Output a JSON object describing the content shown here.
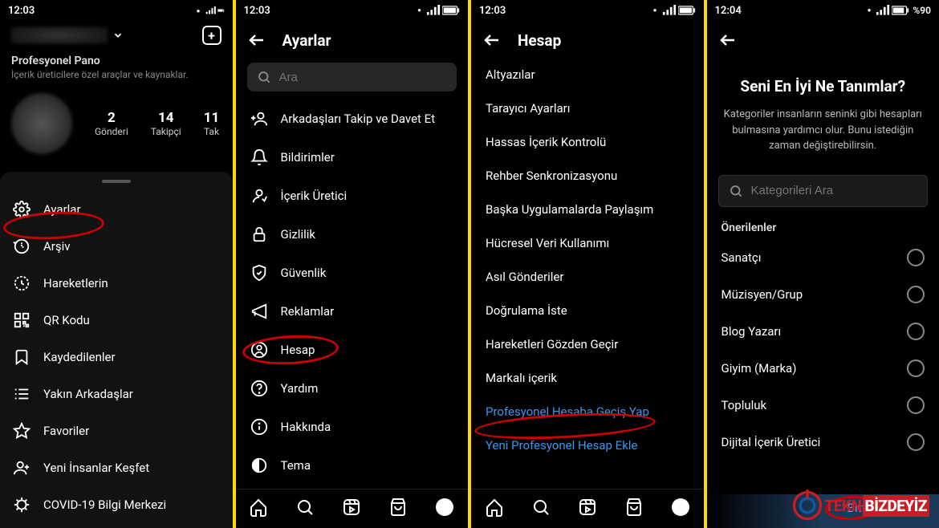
{
  "status": {
    "time1": "12:03",
    "time2": "12:03",
    "time3": "12:03",
    "time4": "12:04",
    "battery4": "%90"
  },
  "screen1": {
    "pano_title": "Profesyonel Pano",
    "pano_sub": "İçerik üreticilere özel araçlar ve kaynaklar.",
    "stats": [
      {
        "num": "2",
        "label": "Gönderi"
      },
      {
        "num": "14",
        "label": "Takipçi"
      },
      {
        "num": "11",
        "label": "Tak"
      }
    ],
    "menu": [
      "Ayarlar",
      "Arşiv",
      "Hareketlerin",
      "QR Kodu",
      "Kaydedilenler",
      "Yakın Arkadaşlar",
      "Favoriler",
      "Yeni İnsanlar Keşfet",
      "COVID-19 Bilgi Merkezi"
    ]
  },
  "screen2": {
    "title": "Ayarlar",
    "search_placeholder": "Ara",
    "items": [
      "Arkadaşları Takip ve Davet Et",
      "Bildirimler",
      "İçerik Üretici",
      "Gizlilik",
      "Güvenlik",
      "Reklamlar",
      "Hesap",
      "Yardım",
      "Hakkında",
      "Tema"
    ]
  },
  "screen3": {
    "title": "Hesap",
    "items": [
      "Altyazılar",
      "Tarayıcı Ayarları",
      "Hassas İçerik Kontrolü",
      "Rehber Senkronizasyonu",
      "Başka Uygulamalarda Paylaşım",
      "Hücresel Veri Kullanımı",
      "Asıl Gönderiler",
      "Doğrulama İste",
      "Hareketleri Gözden Geçir",
      "Markalı içerik"
    ],
    "link1": "Profesyonel Hesaba Geçiş Yap",
    "link2": "Yeni Profesyonel Hesap Ekle"
  },
  "screen4": {
    "title": "Seni En İyi Ne Tanımlar?",
    "desc": "Kategoriler insanların seninki gibi hesapları bulmasına yardımcı olur. Bunu istediğin zaman değiştirebilirsin.",
    "search_placeholder": "Kategorileri Ara",
    "section": "Önerilenler",
    "items": [
      "Sanatçı",
      "Müzisyen/Grup",
      "Blog Yazarı",
      "Giyim (Marka)",
      "Topluluk",
      "Dijital İçerik Üretici"
    ],
    "done": "Bitti",
    "logo_a": "TEKN",
    "logo_b": "BİZDEYİZ"
  }
}
